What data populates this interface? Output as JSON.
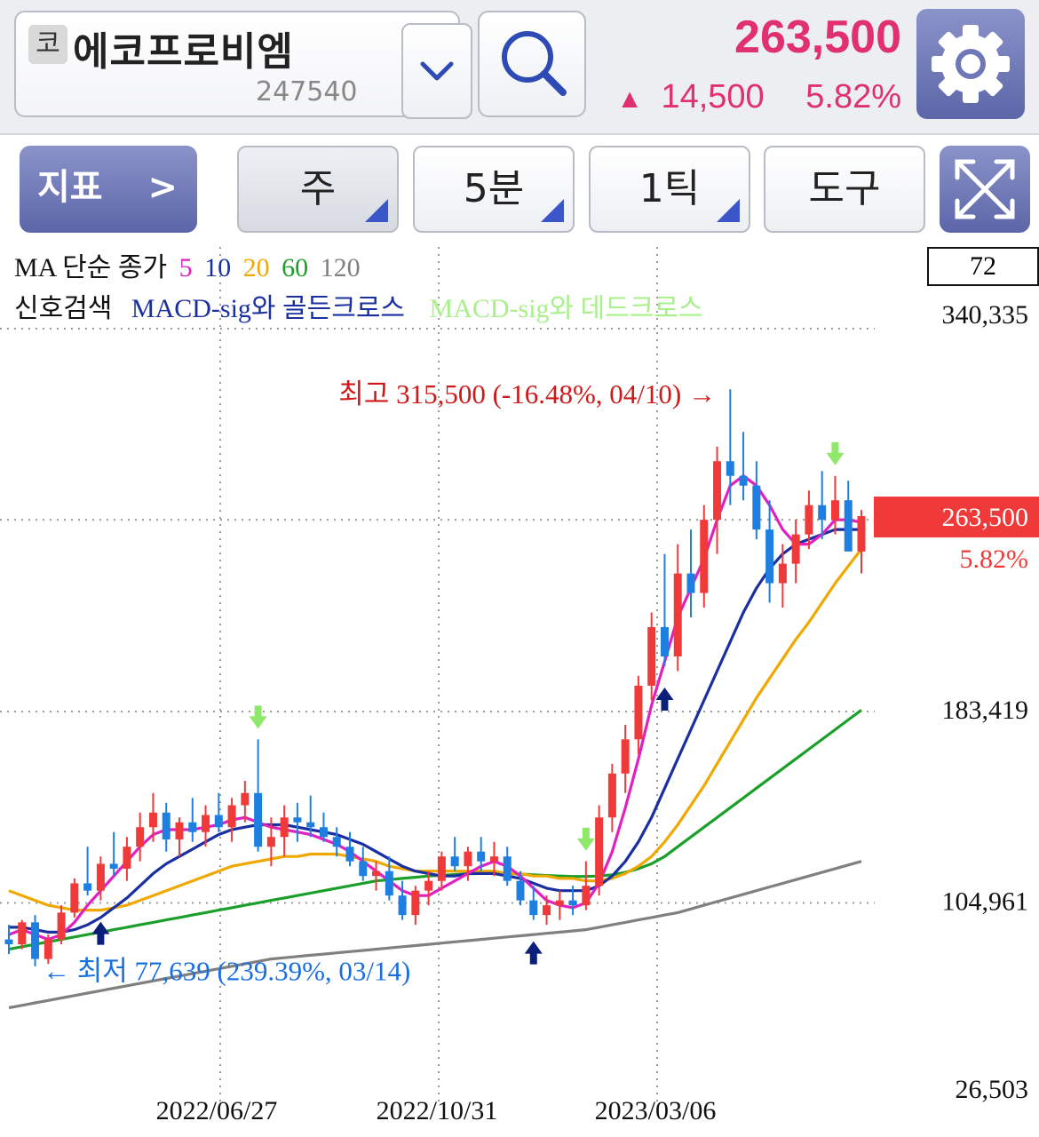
{
  "header": {
    "market_badge": "코",
    "stock_name": "에코프로비엠",
    "stock_code": "247540",
    "price": "263,500",
    "change_arrow": "▲",
    "change_amount": "14,500",
    "change_pct": "5.82%",
    "icons": [
      "chevron-down-icon",
      "search-icon",
      "gear-icon"
    ],
    "price_color": "#e0306e"
  },
  "toolbar": {
    "indicator_label": "지표",
    "indicator_chevron": ">",
    "period_label": "주",
    "minute_label": "5분",
    "tick_label": "1틱",
    "tools_label": "도구",
    "expand_icon": "expand-icon"
  },
  "legend": {
    "ma_title": "MA 단순 종가",
    "ma_periods": [
      {
        "label": "5",
        "color": "#e020c0"
      },
      {
        "label": "10",
        "color": "#1a2fa0"
      },
      {
        "label": "20",
        "color": "#f0a800"
      },
      {
        "label": "60",
        "color": "#1aa02a"
      },
      {
        "label": "120",
        "color": "#808080"
      }
    ],
    "signal_title": "신호검색",
    "signal_golden": "MACD-sig와 골든크로스",
    "signal_dead": "MACD-sig와 데드크로스",
    "signal_golden_color": "#1a2fa0",
    "signal_dead_color": "#a8f08a",
    "box_value": "72"
  },
  "chart_data": {
    "type": "candlestick",
    "y_axis_labels": [
      "340,335",
      "183,419",
      "104,961",
      "26,503"
    ],
    "y_gridlines": [
      340335,
      262000,
      183419,
      104961
    ],
    "ylim": [
      26503,
      340335
    ],
    "x_tick_labels": [
      "2022/06/27",
      "2022/10/31",
      "2023/03/06"
    ],
    "current_price_label": "263,500",
    "current_change_label": "5.82%",
    "high_annotation": "최고 315,500 (-16.48%, 04/10) →",
    "low_annotation": "← 최저 77,639 (239.39%, 03/14)",
    "high_value": 315500,
    "low_value": 77639,
    "up_color": "#f03a3a",
    "down_color": "#1f7fe0",
    "candles": [
      [
        90000,
        96000,
        84000,
        88000
      ],
      [
        88000,
        98000,
        86000,
        97000
      ],
      [
        97000,
        100000,
        79000,
        82000
      ],
      [
        82000,
        92000,
        80000,
        90000
      ],
      [
        90000,
        104000,
        88000,
        101000
      ],
      [
        101000,
        115000,
        99000,
        113000
      ],
      [
        113000,
        128000,
        108000,
        110000
      ],
      [
        110000,
        124000,
        106000,
        121000
      ],
      [
        121000,
        134000,
        116000,
        119000
      ],
      [
        119000,
        132000,
        114000,
        128000
      ],
      [
        128000,
        142000,
        122000,
        136000
      ],
      [
        136000,
        150000,
        130000,
        142000
      ],
      [
        142000,
        146000,
        126000,
        131000
      ],
      [
        131000,
        140000,
        124000,
        138000
      ],
      [
        138000,
        148000,
        130000,
        134000
      ],
      [
        134000,
        145000,
        128000,
        141000
      ],
      [
        141000,
        150000,
        134000,
        136000
      ],
      [
        136000,
        148000,
        130000,
        145000
      ],
      [
        145000,
        155000,
        138000,
        150000
      ],
      [
        150000,
        172000,
        126000,
        128000
      ],
      [
        128000,
        140000,
        120000,
        132000
      ],
      [
        132000,
        145000,
        124000,
        140000
      ],
      [
        140000,
        146000,
        130000,
        138000
      ],
      [
        138000,
        149000,
        132000,
        136000
      ],
      [
        136000,
        142000,
        130000,
        132000
      ],
      [
        132000,
        136000,
        124000,
        128000
      ],
      [
        128000,
        134000,
        120000,
        122000
      ],
      [
        122000,
        128000,
        114000,
        116000
      ],
      [
        116000,
        122000,
        110000,
        118000
      ],
      [
        118000,
        124000,
        106000,
        108000
      ],
      [
        108000,
        114000,
        98000,
        100000
      ],
      [
        100000,
        112000,
        96000,
        110000
      ],
      [
        110000,
        118000,
        104000,
        114000
      ],
      [
        114000,
        126000,
        110000,
        124000
      ],
      [
        124000,
        132000,
        118000,
        120000
      ],
      [
        120000,
        128000,
        114000,
        126000
      ],
      [
        126000,
        132000,
        118000,
        122000
      ],
      [
        122000,
        130000,
        116000,
        124000
      ],
      [
        124000,
        128000,
        112000,
        114000
      ],
      [
        114000,
        118000,
        104000,
        106000
      ],
      [
        106000,
        112000,
        98000,
        100000
      ],
      [
        100000,
        108000,
        96000,
        104000
      ],
      [
        104000,
        110000,
        98000,
        106000
      ],
      [
        106000,
        112000,
        100000,
        104000
      ],
      [
        104000,
        122000,
        102000,
        112000
      ],
      [
        112000,
        145000,
        108000,
        140000
      ],
      [
        140000,
        162000,
        134000,
        158000
      ],
      [
        158000,
        178000,
        150000,
        172000
      ],
      [
        172000,
        198000,
        166000,
        194000
      ],
      [
        194000,
        224000,
        188000,
        218000
      ],
      [
        218000,
        248000,
        202000,
        206000
      ],
      [
        206000,
        252000,
        200000,
        240000
      ],
      [
        240000,
        258000,
        222000,
        232000
      ],
      [
        232000,
        268000,
        226000,
        262000
      ],
      [
        262000,
        292000,
        248000,
        286000
      ],
      [
        286000,
        315500,
        268000,
        280000
      ],
      [
        280000,
        298000,
        270000,
        276000
      ],
      [
        276000,
        286000,
        254000,
        258000
      ],
      [
        258000,
        270000,
        228000,
        236000
      ],
      [
        236000,
        252000,
        226000,
        244000
      ],
      [
        244000,
        262000,
        236000,
        256000
      ],
      [
        256000,
        274000,
        250000,
        268000
      ],
      [
        268000,
        282000,
        254000,
        262000
      ],
      [
        262000,
        280000,
        256000,
        270000
      ],
      [
        270000,
        278000,
        250000,
        249000
      ],
      [
        249000,
        266000,
        240000,
        263500
      ]
    ],
    "ma": {
      "5": [
        92000,
        94000,
        92000,
        90000,
        92000,
        97000,
        104000,
        110000,
        116000,
        122000,
        128000,
        133000,
        135000,
        135000,
        135000,
        136000,
        137000,
        139000,
        140000,
        138000,
        136000,
        135000,
        134000,
        133000,
        131000,
        129000,
        126000,
        122000,
        118000,
        114000,
        110000,
        108000,
        108000,
        111000,
        114000,
        117000,
        120000,
        122000,
        120000,
        116000,
        111000,
        106000,
        104000,
        103000,
        105000,
        113000,
        126000,
        144000,
        164000,
        186000,
        204000,
        222000,
        234000,
        246000,
        262000,
        276000,
        280000,
        276000,
        268000,
        258000,
        252000,
        252000,
        256000,
        262000,
        262000,
        261000
      ],
      "10": [
        95000,
        95000,
        94000,
        93000,
        93000,
        94000,
        96000,
        99000,
        103000,
        107000,
        112000,
        117000,
        121000,
        124000,
        127000,
        130000,
        133000,
        135000,
        136000,
        137000,
        137000,
        137000,
        136000,
        135000,
        134000,
        133000,
        131000,
        129000,
        126000,
        123000,
        120000,
        118000,
        117000,
        116000,
        116000,
        117000,
        117000,
        117000,
        116000,
        115000,
        113000,
        111000,
        110000,
        110000,
        110000,
        112000,
        116000,
        122000,
        130000,
        140000,
        152000,
        164000,
        176000,
        188000,
        200000,
        212000,
        224000,
        234000,
        242000,
        248000,
        252000,
        254000,
        256000,
        258000,
        258000,
        258000
      ],
      "20": [
        110000,
        108000,
        106000,
        104000,
        103000,
        102000,
        102000,
        102000,
        103000,
        104000,
        106000,
        108000,
        110000,
        112000,
        114000,
        116000,
        118000,
        120000,
        121000,
        122000,
        123000,
        124000,
        124000,
        125000,
        125000,
        125000,
        124000,
        123000,
        122000,
        120000,
        119000,
        118000,
        118000,
        118000,
        118000,
        118000,
        118000,
        118000,
        117000,
        117000,
        116000,
        116000,
        115000,
        115000,
        114000,
        114000,
        115000,
        117000,
        120000,
        124000,
        130000,
        137000,
        145000,
        153000,
        162000,
        171000,
        180000,
        189000,
        197000,
        205000,
        213000,
        220000,
        228000,
        236000,
        243000,
        250000
      ],
      "60": [
        86000,
        87000,
        88000,
        89000,
        90000,
        91000,
        92000,
        93000,
        94000,
        95000,
        96000,
        97000,
        98000,
        99000,
        100000,
        101000,
        102000,
        103000,
        104000,
        105000,
        106000,
        107000,
        108000,
        109000,
        110000,
        111000,
        112000,
        113000,
        114000,
        114500,
        115000,
        115500,
        116000,
        116300,
        116600,
        116900,
        117000,
        117000,
        117000,
        116800,
        116500,
        116200,
        116000,
        115800,
        115800,
        116000,
        116500,
        117500,
        119000,
        121000,
        124000,
        128000,
        132000,
        136000,
        140000,
        144000,
        148000,
        152000,
        156000,
        160000,
        164000,
        168000,
        172000,
        176000,
        180000,
        184000
      ],
      "120": [
        62000,
        63000,
        64000,
        65000,
        66000,
        67000,
        68000,
        69000,
        70000,
        71000,
        72000,
        73000,
        74000,
        75000,
        76000,
        77000,
        78000,
        79000,
        80000,
        81000,
        82000,
        82500,
        83000,
        83500,
        84000,
        84500,
        85000,
        85500,
        86000,
        86500,
        87000,
        87500,
        88000,
        88500,
        89000,
        89500,
        90000,
        90500,
        91000,
        91500,
        92000,
        92500,
        93000,
        93500,
        94000,
        95000,
        96000,
        97000,
        98000,
        99000,
        100000,
        101000,
        102500,
        104000,
        105500,
        107000,
        108500,
        110000,
        111500,
        113000,
        114500,
        116000,
        117500,
        119000,
        120500,
        122000
      ]
    },
    "golden_cross_indices": [
      7,
      40,
      50
    ],
    "dead_cross_indices": [
      19,
      44,
      63
    ]
  }
}
